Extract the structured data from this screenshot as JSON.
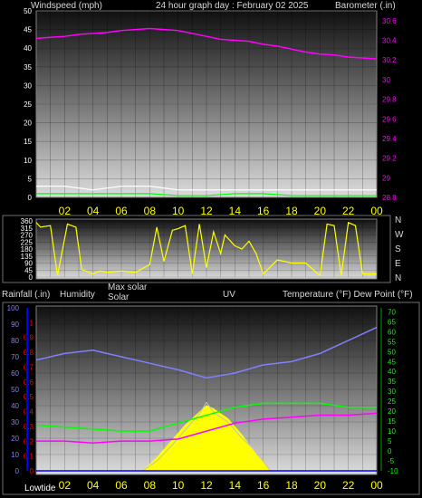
{
  "header": {
    "left": "Windspeed (mph)",
    "center": "24 hour graph day : February 02 2025",
    "right": "Barometer (.in)"
  },
  "direction_letters": [
    "N",
    "W",
    "S",
    "E",
    "N"
  ],
  "labels_mid": {
    "rain": "Rainfall (.in)",
    "humidity": "Humidity",
    "max_solar": "Max solar",
    "solar": "Solar",
    "uv": "UV",
    "temp": "Temperature (°F) Dew Point (°F)"
  },
  "lowtide": "Lowtide",
  "colors": {
    "wind": "#ffffff",
    "gust": "#ffffff",
    "avg": "#00ff00",
    "baro": "#ff00ff",
    "dir": "#ffff00",
    "humidity": "#8080ff",
    "temp": "#00ff00",
    "dew": "#ff00ff",
    "solar": "#ffff00",
    "maxsolar": "#c0c0c0",
    "uv": "#ff8080",
    "rain": "#0000ff"
  },
  "chart_data": [
    {
      "type": "line",
      "x_ticks": [
        "02",
        "04",
        "06",
        "08",
        "10",
        "12",
        "14",
        "16",
        "18",
        "20",
        "22",
        "00"
      ],
      "y_left": {
        "ticks": [
          0,
          5,
          10,
          15,
          20,
          25,
          30,
          35,
          40,
          45,
          50
        ],
        "range": [
          0,
          50
        ]
      },
      "y_right": {
        "ticks": [
          "28.8",
          "29",
          "29.2",
          "29.4",
          "29.6",
          "29.8",
          "30",
          "30.2",
          "30.4",
          "30.6"
        ],
        "range": [
          28.8,
          30.7
        ]
      },
      "series": [
        {
          "x": [
            0,
            1,
            2,
            3,
            4,
            5,
            6,
            7,
            8,
            9,
            10,
            11,
            12,
            13,
            14,
            15,
            16,
            17,
            18,
            19,
            20,
            21,
            22,
            23,
            24
          ],
          "values": [
            30.42,
            30.43,
            30.44,
            30.46,
            30.47,
            30.48,
            30.5,
            30.51,
            30.52,
            30.51,
            30.5,
            30.47,
            30.44,
            30.41,
            30.4,
            30.39,
            30.36,
            30.34,
            30.31,
            30.28,
            30.26,
            30.25,
            30.23,
            30.22,
            30.21
          ]
        },
        {
          "x": [
            0,
            2,
            4,
            6,
            8,
            10,
            12,
            14,
            16,
            18,
            20,
            22,
            24
          ],
          "values": [
            3,
            3,
            2,
            3,
            3,
            2,
            2,
            2,
            2,
            2,
            2,
            2,
            2
          ]
        },
        {
          "x": [
            0,
            2,
            4,
            6,
            8,
            10,
            12,
            14,
            16,
            18,
            20,
            22,
            24
          ],
          "values": [
            1,
            1,
            1,
            1,
            1,
            0.5,
            0.5,
            1,
            1,
            0.5,
            0.5,
            0.5,
            0.5
          ]
        }
      ]
    },
    {
      "type": "line",
      "x_ticks": [],
      "y_left": {
        "ticks": [
          0,
          45,
          90,
          135,
          180,
          225,
          270,
          315,
          360
        ],
        "range": [
          0,
          360
        ]
      },
      "series": [
        {
          "x": [
            0,
            0.3,
            1,
            1.5,
            2.2,
            2.8,
            3.2,
            4,
            4.5,
            5,
            6,
            7,
            8,
            8.5,
            9,
            9.6,
            10,
            10.5,
            11,
            11.5,
            12,
            12.5,
            13,
            13.3,
            14,
            14.5,
            15,
            15.5,
            16,
            17,
            18,
            19,
            20,
            20.5,
            21,
            21.5,
            22,
            22.5,
            23,
            24
          ],
          "values": [
            350,
            320,
            330,
            10,
            340,
            320,
            50,
            20,
            40,
            30,
            40,
            30,
            80,
            320,
            100,
            300,
            310,
            330,
            20,
            340,
            60,
            290,
            150,
            270,
            200,
            180,
            230,
            150,
            20,
            110,
            90,
            90,
            10,
            340,
            330,
            10,
            350,
            330,
            20,
            20
          ]
        }
      ]
    },
    {
      "type": "area",
      "x_ticks": [
        "02",
        "04",
        "06",
        "08",
        "10",
        "12",
        "14",
        "16",
        "18",
        "20",
        "22",
        "00"
      ],
      "y_left": {
        "ticks": [
          0,
          10,
          20,
          30,
          40,
          50,
          60,
          70,
          80,
          90,
          100
        ],
        "range": [
          0,
          100
        ]
      },
      "y_rain": {
        "ticks": [
          0,
          0.1,
          0.2,
          0.3,
          0.4,
          0.5,
          0.6,
          0.7,
          0.8,
          0.9,
          1
        ],
        "range": [
          0,
          1.1
        ]
      },
      "y_right": {
        "ticks": [
          -10,
          -5,
          0,
          5,
          10,
          15,
          20,
          25,
          30,
          35,
          40,
          45,
          50,
          55,
          60,
          65,
          70
        ],
        "range": [
          -10,
          72
        ]
      },
      "series": [
        {
          "x": [
            0,
            2,
            4,
            6,
            8,
            10,
            12,
            14,
            16,
            18,
            20,
            22,
            24
          ],
          "values": [
            68,
            72,
            74,
            70,
            66,
            62,
            57,
            60,
            65,
            67,
            72,
            80,
            88
          ]
        },
        {
          "x": [
            0,
            2,
            4,
            6,
            8,
            10,
            12,
            14,
            16,
            18,
            20,
            22,
            24
          ],
          "values": [
            13,
            12,
            11,
            10,
            10,
            14,
            18,
            22,
            24,
            24,
            24,
            22,
            22
          ]
        },
        {
          "x": [
            0,
            2,
            4,
            6,
            8,
            10,
            12,
            14,
            16,
            18,
            20,
            22,
            24
          ],
          "values": [
            5,
            5,
            4,
            5,
            5,
            6,
            10,
            14,
            16,
            17,
            18,
            18,
            19
          ]
        },
        {
          "x": [
            7.5,
            8.5,
            9.5,
            10.5,
            11.5,
            12,
            12.5,
            13.5,
            14.5,
            15.5,
            16.5
          ],
          "values": [
            0,
            8,
            18,
            28,
            36,
            40,
            38,
            32,
            22,
            10,
            0
          ]
        },
        {
          "x": [
            7.5,
            8.5,
            9.5,
            10.5,
            11.5,
            12,
            12.5,
            13.5,
            14.5,
            15.5,
            16.5
          ],
          "values": [
            0,
            6,
            15,
            25,
            35,
            42,
            36,
            30,
            20,
            12,
            0
          ]
        },
        {
          "x": [
            0,
            24
          ],
          "values": [
            0,
            0
          ]
        }
      ]
    }
  ]
}
